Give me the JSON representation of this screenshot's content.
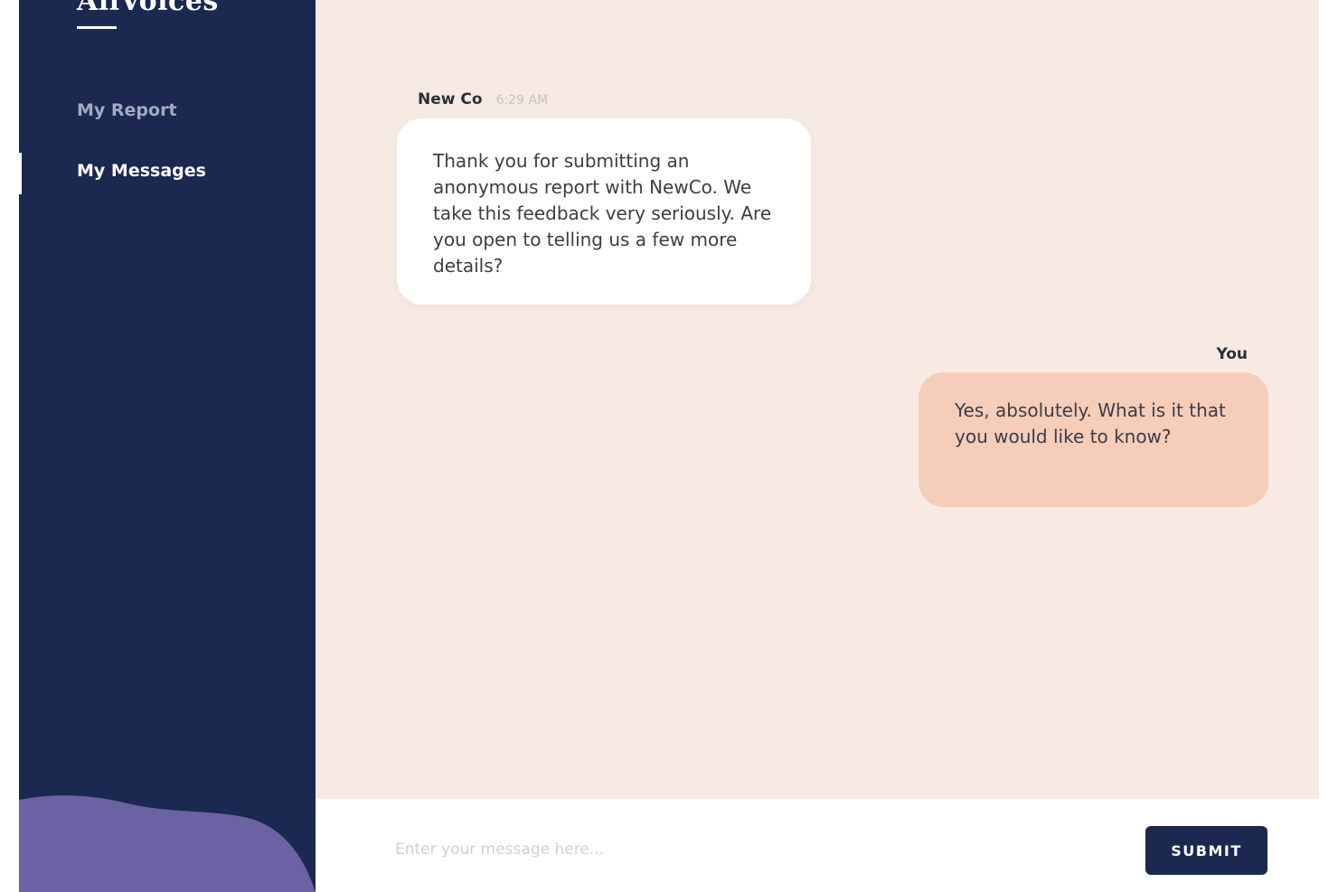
{
  "brand": {
    "logo_text": "AllVoices"
  },
  "sidebar": {
    "items": [
      {
        "label": "My Report",
        "active": false
      },
      {
        "label": "My Messages",
        "active": true
      }
    ]
  },
  "chat": {
    "messages": [
      {
        "sender": "New Co",
        "time": "6:29 AM",
        "text": "Thank you for submitting an anonymous report with NewCo. We take this feedback very seriously. Are you open to telling us a few more details?"
      },
      {
        "sender": "You",
        "text": "Yes, absolutely. What is it that you would like to know?"
      }
    ]
  },
  "composer": {
    "placeholder": "Enter your message here...",
    "value": "",
    "submit_label": "SUBMIT"
  },
  "colors": {
    "sidebar_bg": "#1b2850",
    "chat_bg": "#f6eae3",
    "incoming_bubble": "#ffffff",
    "outgoing_bubble": "#f5cdb8",
    "wave": "#6c61a3",
    "button_bg": "#1b2850"
  }
}
